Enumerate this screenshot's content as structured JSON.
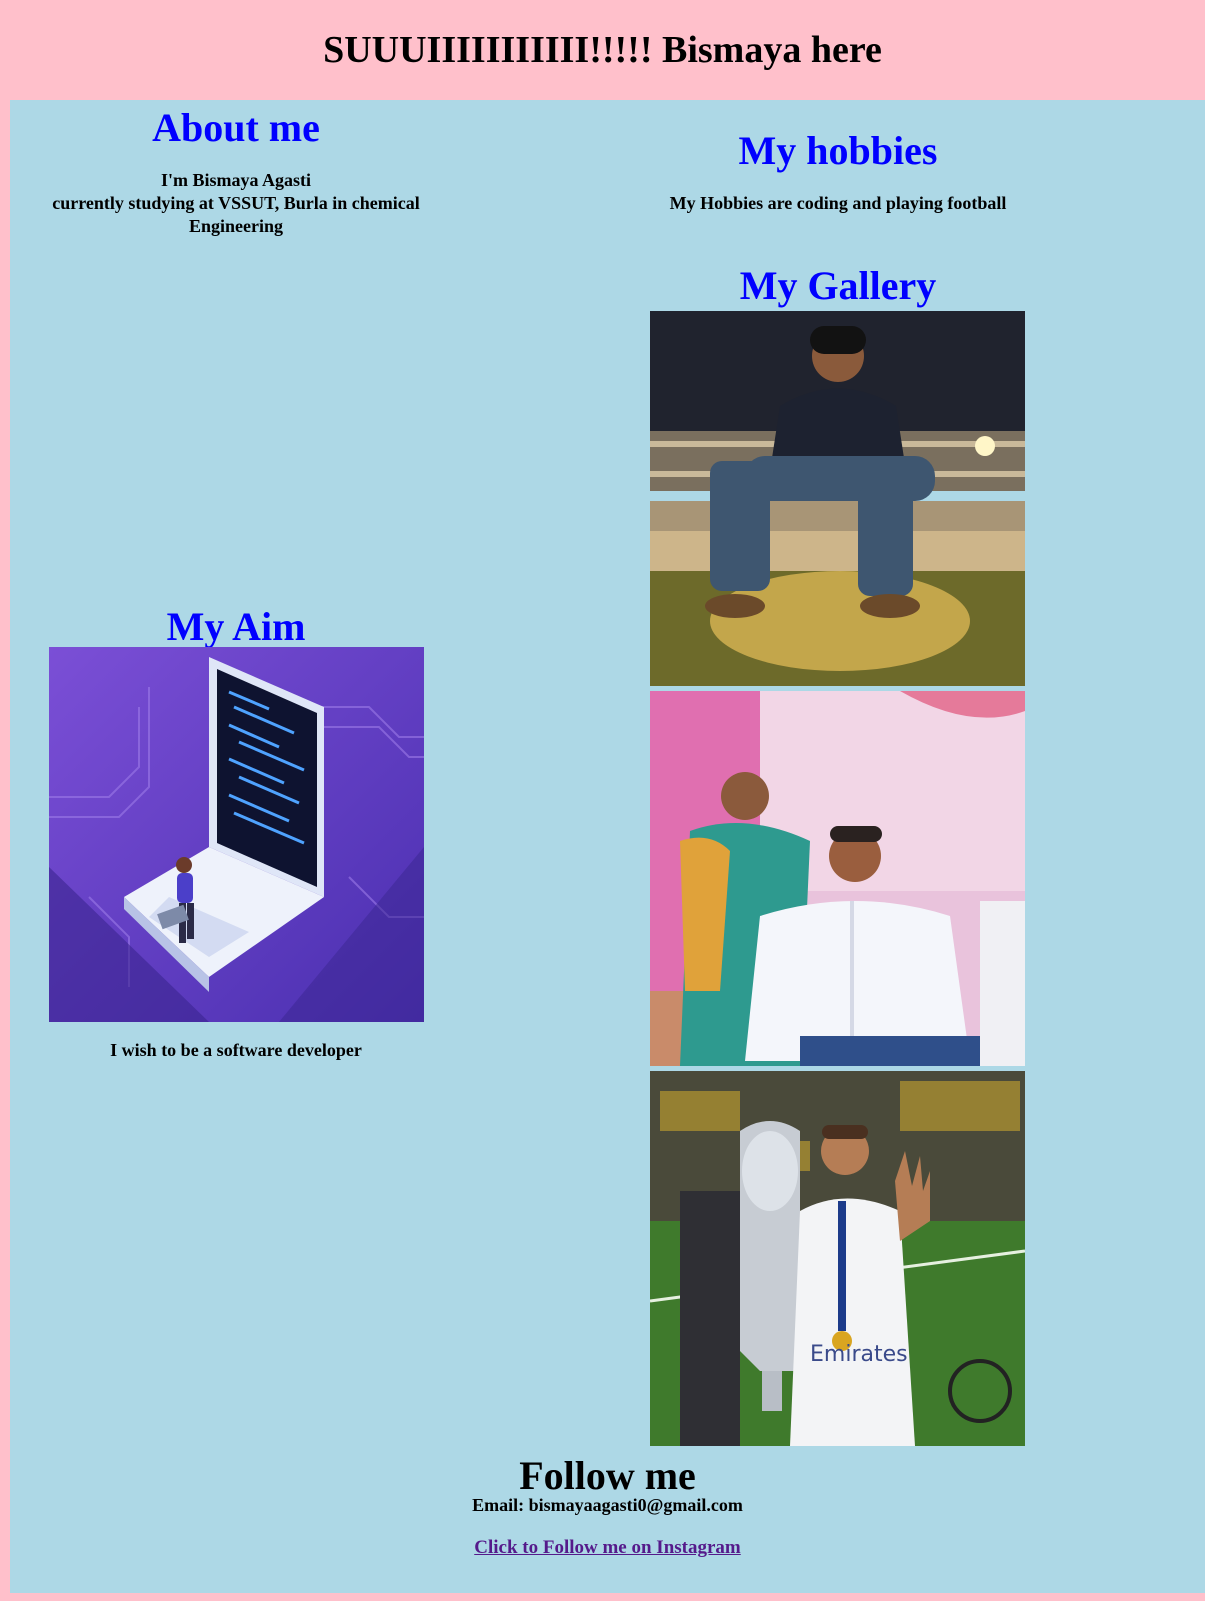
{
  "header": {
    "title": "SUUUIIIIIIIIIII!!!!! Bismaya here"
  },
  "about": {
    "title": "About me",
    "line1": "I'm Bismaya Agasti",
    "line2": "currently studying at VSSUT, Burla in chemical",
    "line3": "Engineering"
  },
  "aim": {
    "title": "My Aim",
    "text": "I wish to be a software developer"
  },
  "hobbies": {
    "title": "My hobbies",
    "text": "My Hobbies are coding and playing football"
  },
  "gallery": {
    "title": "My Gallery"
  },
  "footer": {
    "title": "Follow me",
    "email": "Email: bismayaagasti0@gmail.com",
    "instagram_link": "Click to Follow me on Instagram"
  },
  "colors": {
    "page_bg": "#ffc0cb",
    "content_bg": "#add8e6",
    "heading": "#0000ff",
    "link": "#551a8b"
  }
}
